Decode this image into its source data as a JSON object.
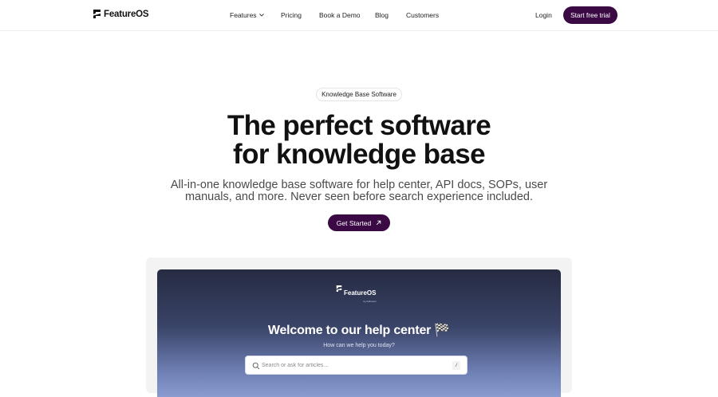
{
  "header": {
    "brand": "FeatureOS",
    "nav": [
      {
        "label": "Features",
        "has_dropdown": true
      },
      {
        "label": "Pricing"
      },
      {
        "label": "Book a Demo"
      },
      {
        "label": "Blog"
      },
      {
        "label": "Customers"
      }
    ],
    "login_label": "Login",
    "trial_label": "Start free trial"
  },
  "hero": {
    "badge": "Knowledge Base Software",
    "title_line1": "The perfect software",
    "title_line2": "for knowledge base",
    "subtitle_line1": "All-in-one knowledge base software for help center, API docs, SOPs, user",
    "subtitle_line2": "manuals, and more. Never seen before search experience included.",
    "cta_label": "Get Started",
    "cta_icon": "arrow-up-right-icon"
  },
  "preview": {
    "brand": "FeatureOS",
    "brand_sub": "by hellonext",
    "title": "Welcome to our help center 🏁",
    "subtitle": "How can we help you today?",
    "search_placeholder": "Search or ask for articles...",
    "shortcut": "/"
  },
  "colors": {
    "accent": "#3b0a45",
    "preview_gradient_top": "#262b42",
    "preview_gradient_bottom": "#8a9bd0"
  }
}
